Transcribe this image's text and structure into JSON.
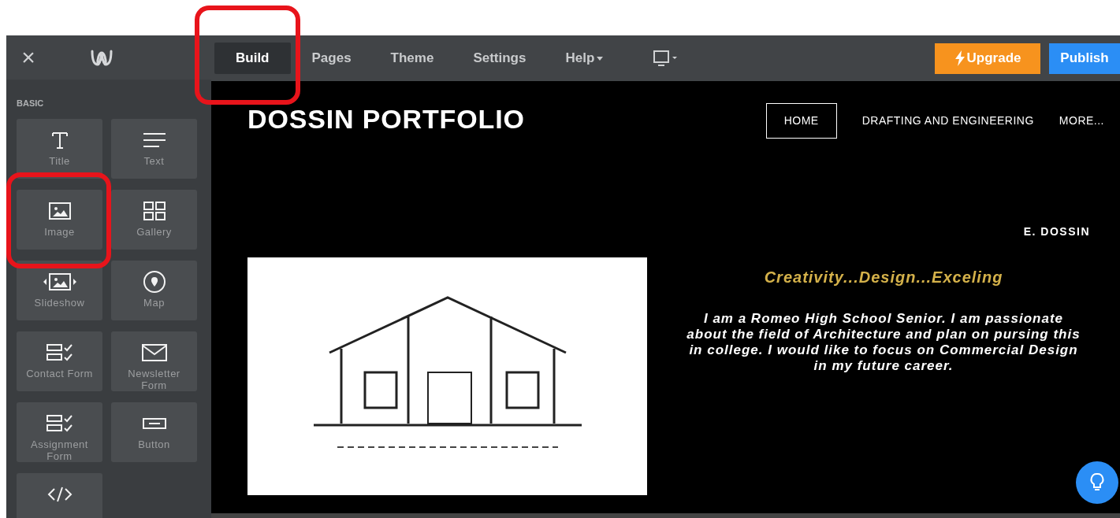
{
  "toolbar": {
    "close": "×",
    "tabs": [
      {
        "label": "Build",
        "selected": true
      },
      {
        "label": "Pages",
        "selected": false
      },
      {
        "label": "Theme",
        "selected": false
      },
      {
        "label": "Settings",
        "selected": false
      },
      {
        "label": "Help",
        "selected": false
      }
    ],
    "upgrade": "Upgrade",
    "publish": "Publish"
  },
  "sidebar": {
    "heading": "BASIC",
    "items": [
      {
        "kind": "title",
        "label": "Title"
      },
      {
        "kind": "text",
        "label": "Text"
      },
      {
        "kind": "image",
        "label": "Image"
      },
      {
        "kind": "gallery",
        "label": "Gallery"
      },
      {
        "kind": "slideshow",
        "label": "Slideshow"
      },
      {
        "kind": "map",
        "label": "Map"
      },
      {
        "kind": "form",
        "label": "Contact Form"
      },
      {
        "kind": "newsletter",
        "label": "Newsletter Form"
      },
      {
        "kind": "form",
        "label": "Assignment Form"
      },
      {
        "kind": "button",
        "label": "Button"
      },
      {
        "kind": "code"
      }
    ]
  },
  "site": {
    "title": "DOSSIN PORTFOLIO",
    "nav": [
      {
        "label": "HOME",
        "selected": true
      },
      {
        "label": "DRAFTING AND ENGINEERING",
        "selected": false
      },
      {
        "label": "MORE...",
        "selected": false
      }
    ],
    "author": "E. DOSSIN",
    "tagline": "Creativity...Design...Exceling",
    "bio": "I am a Romeo High School Senior. I am passionate about the field of Architecture and plan on pursing this in college. I would like to focus on Commercial Design in my future career."
  }
}
